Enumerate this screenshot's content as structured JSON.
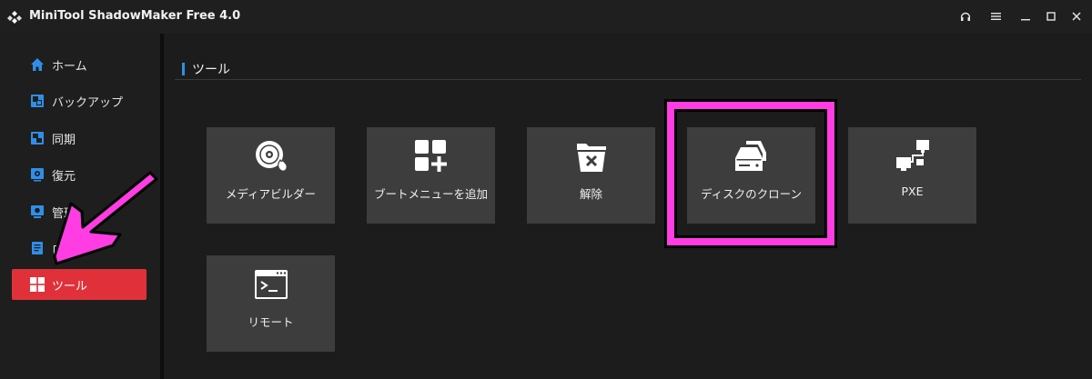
{
  "titlebar": {
    "title": "MiniTool ShadowMaker Free 4.0",
    "logo_icon": "minitool-logo-icon",
    "controls": [
      "headphones-icon",
      "menu-icon",
      "minimize-icon",
      "maximize-icon",
      "close-icon"
    ]
  },
  "sidebar": {
    "items": [
      {
        "label": "ホーム",
        "icon": "home-icon",
        "active": false
      },
      {
        "label": "バックアップ",
        "icon": "backup-icon",
        "active": false
      },
      {
        "label": "同期",
        "icon": "sync-icon",
        "active": false
      },
      {
        "label": "復元",
        "icon": "restore-icon",
        "active": false
      },
      {
        "label": "管理",
        "icon": "manage-icon",
        "active": false
      },
      {
        "label": "ログ",
        "icon": "log-icon",
        "active": false
      },
      {
        "label": "ツール",
        "icon": "tools-icon",
        "active": true
      }
    ],
    "active_color": "#e0313b"
  },
  "main": {
    "section_title": "ツール",
    "accent": "#2f8fe8",
    "tiles": [
      {
        "label": "メディアビルダー",
        "icon": "media-builder-icon"
      },
      {
        "label": "ブートメニューを追加",
        "icon": "add-boot-menu-icon"
      },
      {
        "label": "解除",
        "icon": "unmount-icon"
      },
      {
        "label": "ディスクのクローン",
        "icon": "disk-clone-icon"
      },
      {
        "label": "PXE",
        "icon": "pxe-icon"
      },
      {
        "label": "リモート",
        "icon": "remote-icon"
      }
    ]
  },
  "annotation": {
    "highlight_color": "#ff3de3"
  }
}
